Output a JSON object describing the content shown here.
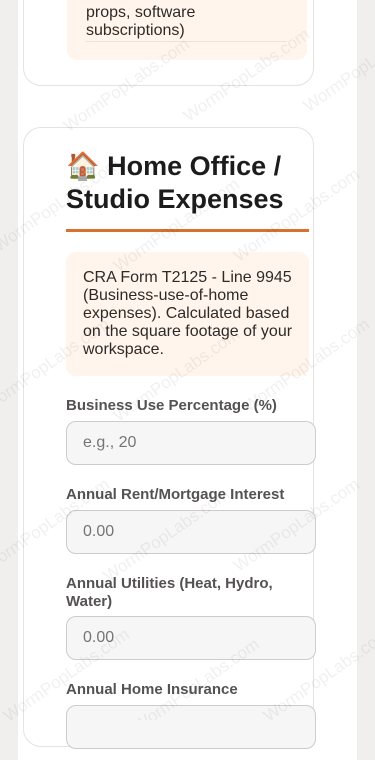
{
  "previous_card": {
    "note_text": "props, software subscriptions)"
  },
  "section": {
    "icon": "house-icon",
    "icon_glyph": "🏠",
    "title": "Home Office / Studio Expenses",
    "accent_color": "#d9702f",
    "note": "CRA Form T2125 - Line 9945 (Business-use-of-home expenses). Calculated based on the square footage of your workspace."
  },
  "fields": {
    "business_use": {
      "label": "Business Use Percentage (%)",
      "placeholder": "e.g., 20"
    },
    "rent": {
      "label": "Annual Rent/Mortgage Interest",
      "placeholder": "0.00"
    },
    "utilities": {
      "label": "Annual Utilities (Heat, Hydro, Water)",
      "placeholder": "0.00"
    },
    "insurance": {
      "label": "Annual Home Insurance",
      "placeholder": ""
    }
  },
  "watermark": "WormPopLabs.com"
}
